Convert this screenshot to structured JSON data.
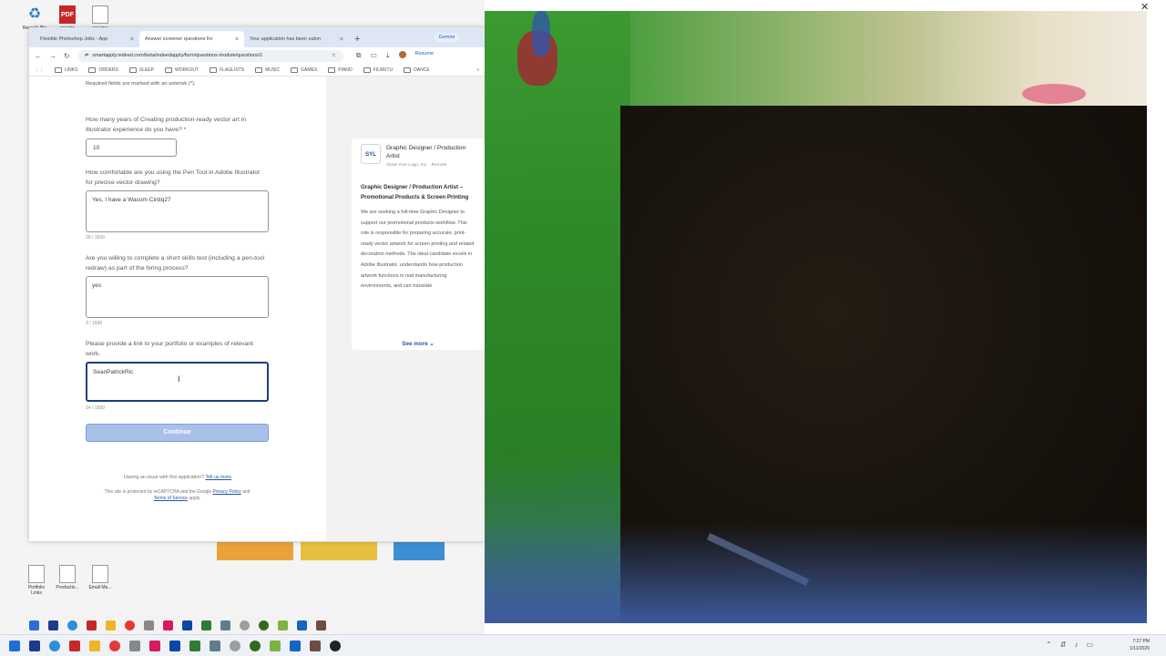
{
  "desktop": {
    "icons": [
      {
        "label": "Recycle Bin",
        "icon": "recycle-icon"
      },
      {
        "label": "resume",
        "icon": "pdf-icon",
        "badge": "PDF"
      },
      {
        "label": "resume",
        "icon": "file-icon"
      }
    ],
    "bottom_icons": [
      {
        "label": "Portfolio Links"
      },
      {
        "label": "Productio..."
      },
      {
        "label": "Email Ma..."
      }
    ]
  },
  "browser": {
    "tabs": [
      {
        "label": "Flexible Photoshop Jobs - App",
        "active": false
      },
      {
        "label": "Answer screener questions fro",
        "active": true
      },
      {
        "label": "Your application has been subm",
        "active": false
      }
    ],
    "new_tab": "+",
    "gemini_label": "Gemini",
    "url": "smartapply.indeed.com/beta/indeedapply/form/questions-module/questions/1",
    "resume_chip": "Resume",
    "bookmarks": [
      "LINKS",
      "ORDERS",
      "SLEEP",
      "WORKOUT",
      "FLAGLISTS",
      "MUSIC",
      "GAMES",
      "PIANO",
      "FILMSTU",
      "DANCE"
    ]
  },
  "form": {
    "required_note": "Required fields are marked with an asterisk (*).",
    "q1": {
      "label": "How many years of Creating production-ready vector art in Illustrator experience do you have? *",
      "value": "10"
    },
    "q2": {
      "label": "How comfortable are you using the Pen Tool in Adobe Illustrator for precise vector drawing?",
      "value": "Yes, I have a Wacom Cintiq27",
      "count": "29 / 1500"
    },
    "q3": {
      "label": "Are you willing to complete a short skills test (including a pen-tool redraw) as part of the hiring process?",
      "value": "yes",
      "count": "3 / 1500"
    },
    "q4": {
      "label": "Please provide a link to your portfolio or examples of relevant work.",
      "value": "SeanPatrickRic",
      "count": "14 / 1500"
    },
    "continue_label": "Continue",
    "issue_text": "Having an issue with this application?",
    "issue_link": "Tell us more",
    "legal_prefix": "This site is protected by reCAPTCHA and the Google",
    "privacy_link": "Privacy Policy",
    "legal_and": "and",
    "terms_link": "Terms of Service",
    "legal_suffix": "apply."
  },
  "job": {
    "logo": "SYL",
    "title": "Graphic Designer / Production Artist",
    "company": "Show Your Logo, Inc. · Remote",
    "heading": "Graphic Designer / Production Artist – Promotional Products & Screen Printing",
    "description": "We are seeking a full-time Graphic Designer to support our promotional products workflow. This role is responsible for preparing accurate, print-ready vector artwork for screen printing and related decoration methods. The ideal candidate excels in Adobe Illustrator, understands how production artwork functions in real manufacturing environments, and can translate",
    "see_more": "See more"
  },
  "taskbar": {
    "time": "7:27 PM",
    "date": "1/11/2026"
  }
}
